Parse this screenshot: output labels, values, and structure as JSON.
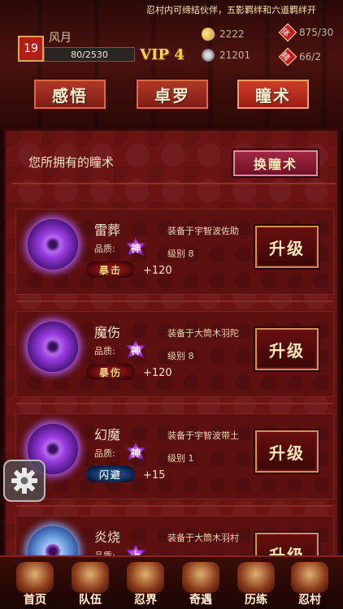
{
  "header": {
    "marquee": "忍村内可缔结伙伴，五影羁绊和六道羁绊开",
    "level": "19",
    "player_name": "风月",
    "exp": "80/2530",
    "vip": "VIP 4",
    "gold": "2222",
    "silver": "21201",
    "stamina": "875/30",
    "spirit": "66/2",
    "seal_top": "体",
    "seal_bottom": "精"
  },
  "top_tabs": [
    "感悟",
    "卓罗",
    "瞳术"
  ],
  "active_tab": 2,
  "panel": {
    "title": "您所拥有的瞳术",
    "swap_button": "换瞳术"
  },
  "cards": [
    {
      "name": "雷葬",
      "quality_label": "品质:",
      "quality": "神",
      "attr": "暴击",
      "bonus": "+120",
      "equip": "装备于宇智波佐助",
      "grade": "级别 8",
      "button": "升级",
      "orb": "purple",
      "attr_color": "red"
    },
    {
      "name": "魔伤",
      "quality_label": "品质:",
      "quality": "神",
      "attr": "暴伤",
      "bonus": "+120",
      "equip": "装备于大筒木羽陀",
      "grade": "级别 8",
      "button": "升级",
      "orb": "purple",
      "attr_color": "red"
    },
    {
      "name": "幻魔",
      "quality_label": "品质:",
      "quality": "神",
      "attr": "闪避",
      "bonus": "+15",
      "equip": "装备于宇智波带土",
      "grade": "级别 1",
      "button": "升级",
      "orb": "purple",
      "attr_color": "blue"
    },
    {
      "name": "炎烧",
      "quality_label": "品质:",
      "quality": "上",
      "attr": "",
      "bonus": "",
      "equip": "装备于大筒木羽村",
      "grade": "",
      "button": "升级",
      "orb": "blue",
      "attr_color": "red"
    }
  ],
  "nav": [
    "首页",
    "队伍",
    "忍界",
    "奇遇",
    "历练",
    "忍村"
  ],
  "colors": {
    "panel_bg": "#6b1414",
    "accent_gold": "#ffd24a",
    "god_purple": "#9a3ce0"
  },
  "icons": {
    "settings": "gear-icon"
  }
}
